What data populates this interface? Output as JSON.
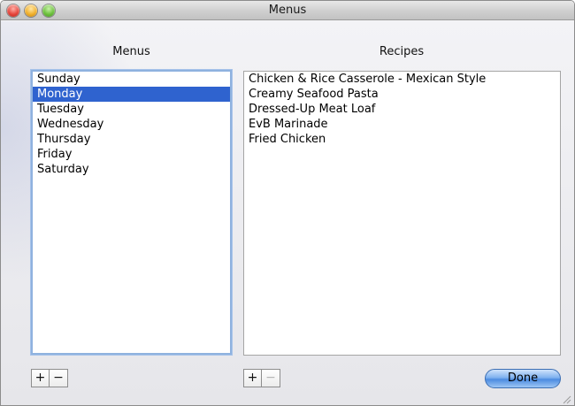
{
  "window": {
    "title": "Menus"
  },
  "menus_panel": {
    "label": "Menus",
    "items": [
      "Sunday",
      "Monday",
      "Tuesday",
      "Wednesday",
      "Thursday",
      "Friday",
      "Saturday"
    ],
    "selected_index": 1,
    "add_label": "+",
    "remove_label": "−"
  },
  "recipes_panel": {
    "label": "Recipes",
    "items": [
      "Chicken & Rice Casserole - Mexican Style",
      "Creamy Seafood Pasta",
      "Dressed-Up Meat Loaf",
      "EvB Marinade",
      "Fried Chicken"
    ],
    "add_label": "+",
    "remove_label": "−",
    "remove_enabled": false
  },
  "done_label": "Done",
  "colors": {
    "selection": "#2f63cf",
    "accent": "#4c8be0"
  }
}
